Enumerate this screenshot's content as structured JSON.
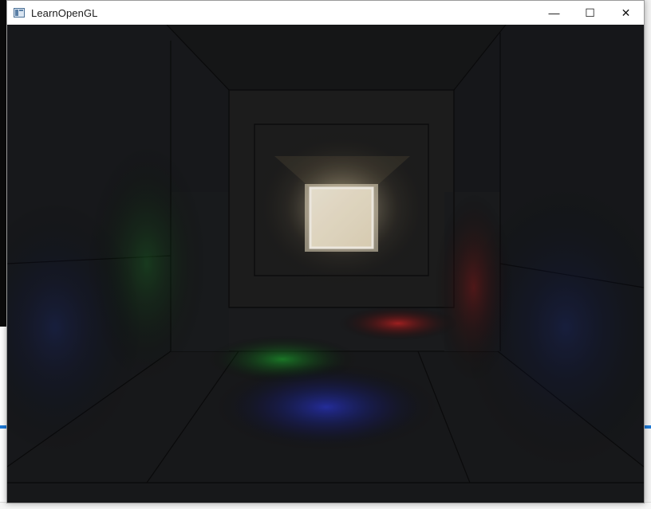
{
  "window": {
    "title": "LearnOpenGL",
    "icon": "opengl-window-icon",
    "controls": {
      "minimize_glyph": "—",
      "maximize_glyph": "☐",
      "close_glyph": "✕"
    }
  },
  "scene": {
    "type": "opengl-render",
    "description_colors": {
      "center_light": "#fbf2dc",
      "green_light": "#1f9a2c",
      "red_light": "#c21f1f",
      "blue_light": "#2332b8",
      "wall": "#1c1d1f"
    }
  },
  "colors": {
    "titlebar_bg": "#ffffff",
    "accent_blue": "#1e7ad6"
  }
}
